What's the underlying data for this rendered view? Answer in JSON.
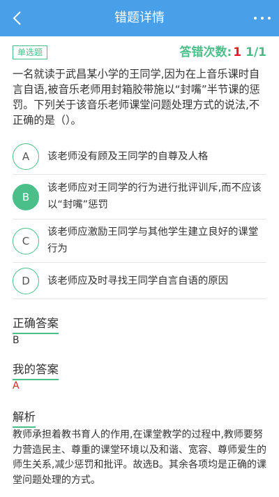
{
  "header": {
    "title": "错题详情",
    "back_icon": "chevron-left-icon",
    "more_icon": "more-horizontal-icon"
  },
  "question": {
    "type": "单选题",
    "error_label": "答错次数:",
    "error_count": "1",
    "page": "1/1",
    "text": "一名就读于武昌某小学的王同学,因为在上音乐课时自言自语,被音乐老师用封箱胶带施以“封嘴”半节课的惩罚。下列关于该音乐老师课堂问题处理方式的说法,不正确的是（）。"
  },
  "options": [
    {
      "letter": "A",
      "text": "该老师没有顾及王同学的自尊及人格",
      "selected": false
    },
    {
      "letter": "B",
      "text": "该老师应对王同学的行为进行批评训斥,而不应该以“封嘴”惩罚",
      "selected": true
    },
    {
      "letter": "C",
      "text": "该老师应激励王同学与其他学生建立良好的课堂行为",
      "selected": false
    },
    {
      "letter": "D",
      "text": "该老师应及时寻找王同学自言自语的原因",
      "selected": false
    }
  ],
  "correct_answer": {
    "title": "正确答案",
    "value": "B"
  },
  "my_answer": {
    "title": "我的答案",
    "value": "A"
  },
  "analysis": {
    "title": "解析",
    "text": "教师承担着教书育人的作用,在课堂教学的过程中,教师要努力营造民主、尊重的课堂环境以及和谐、宽容、尊师爱生的师生关系,减少惩罚和批评。故选B。其余各项均是正确的课堂问题处理的方式。"
  },
  "colors": {
    "header_bg": "#4aa0e8",
    "accent": "#4bbf8a",
    "error": "#e02020"
  }
}
